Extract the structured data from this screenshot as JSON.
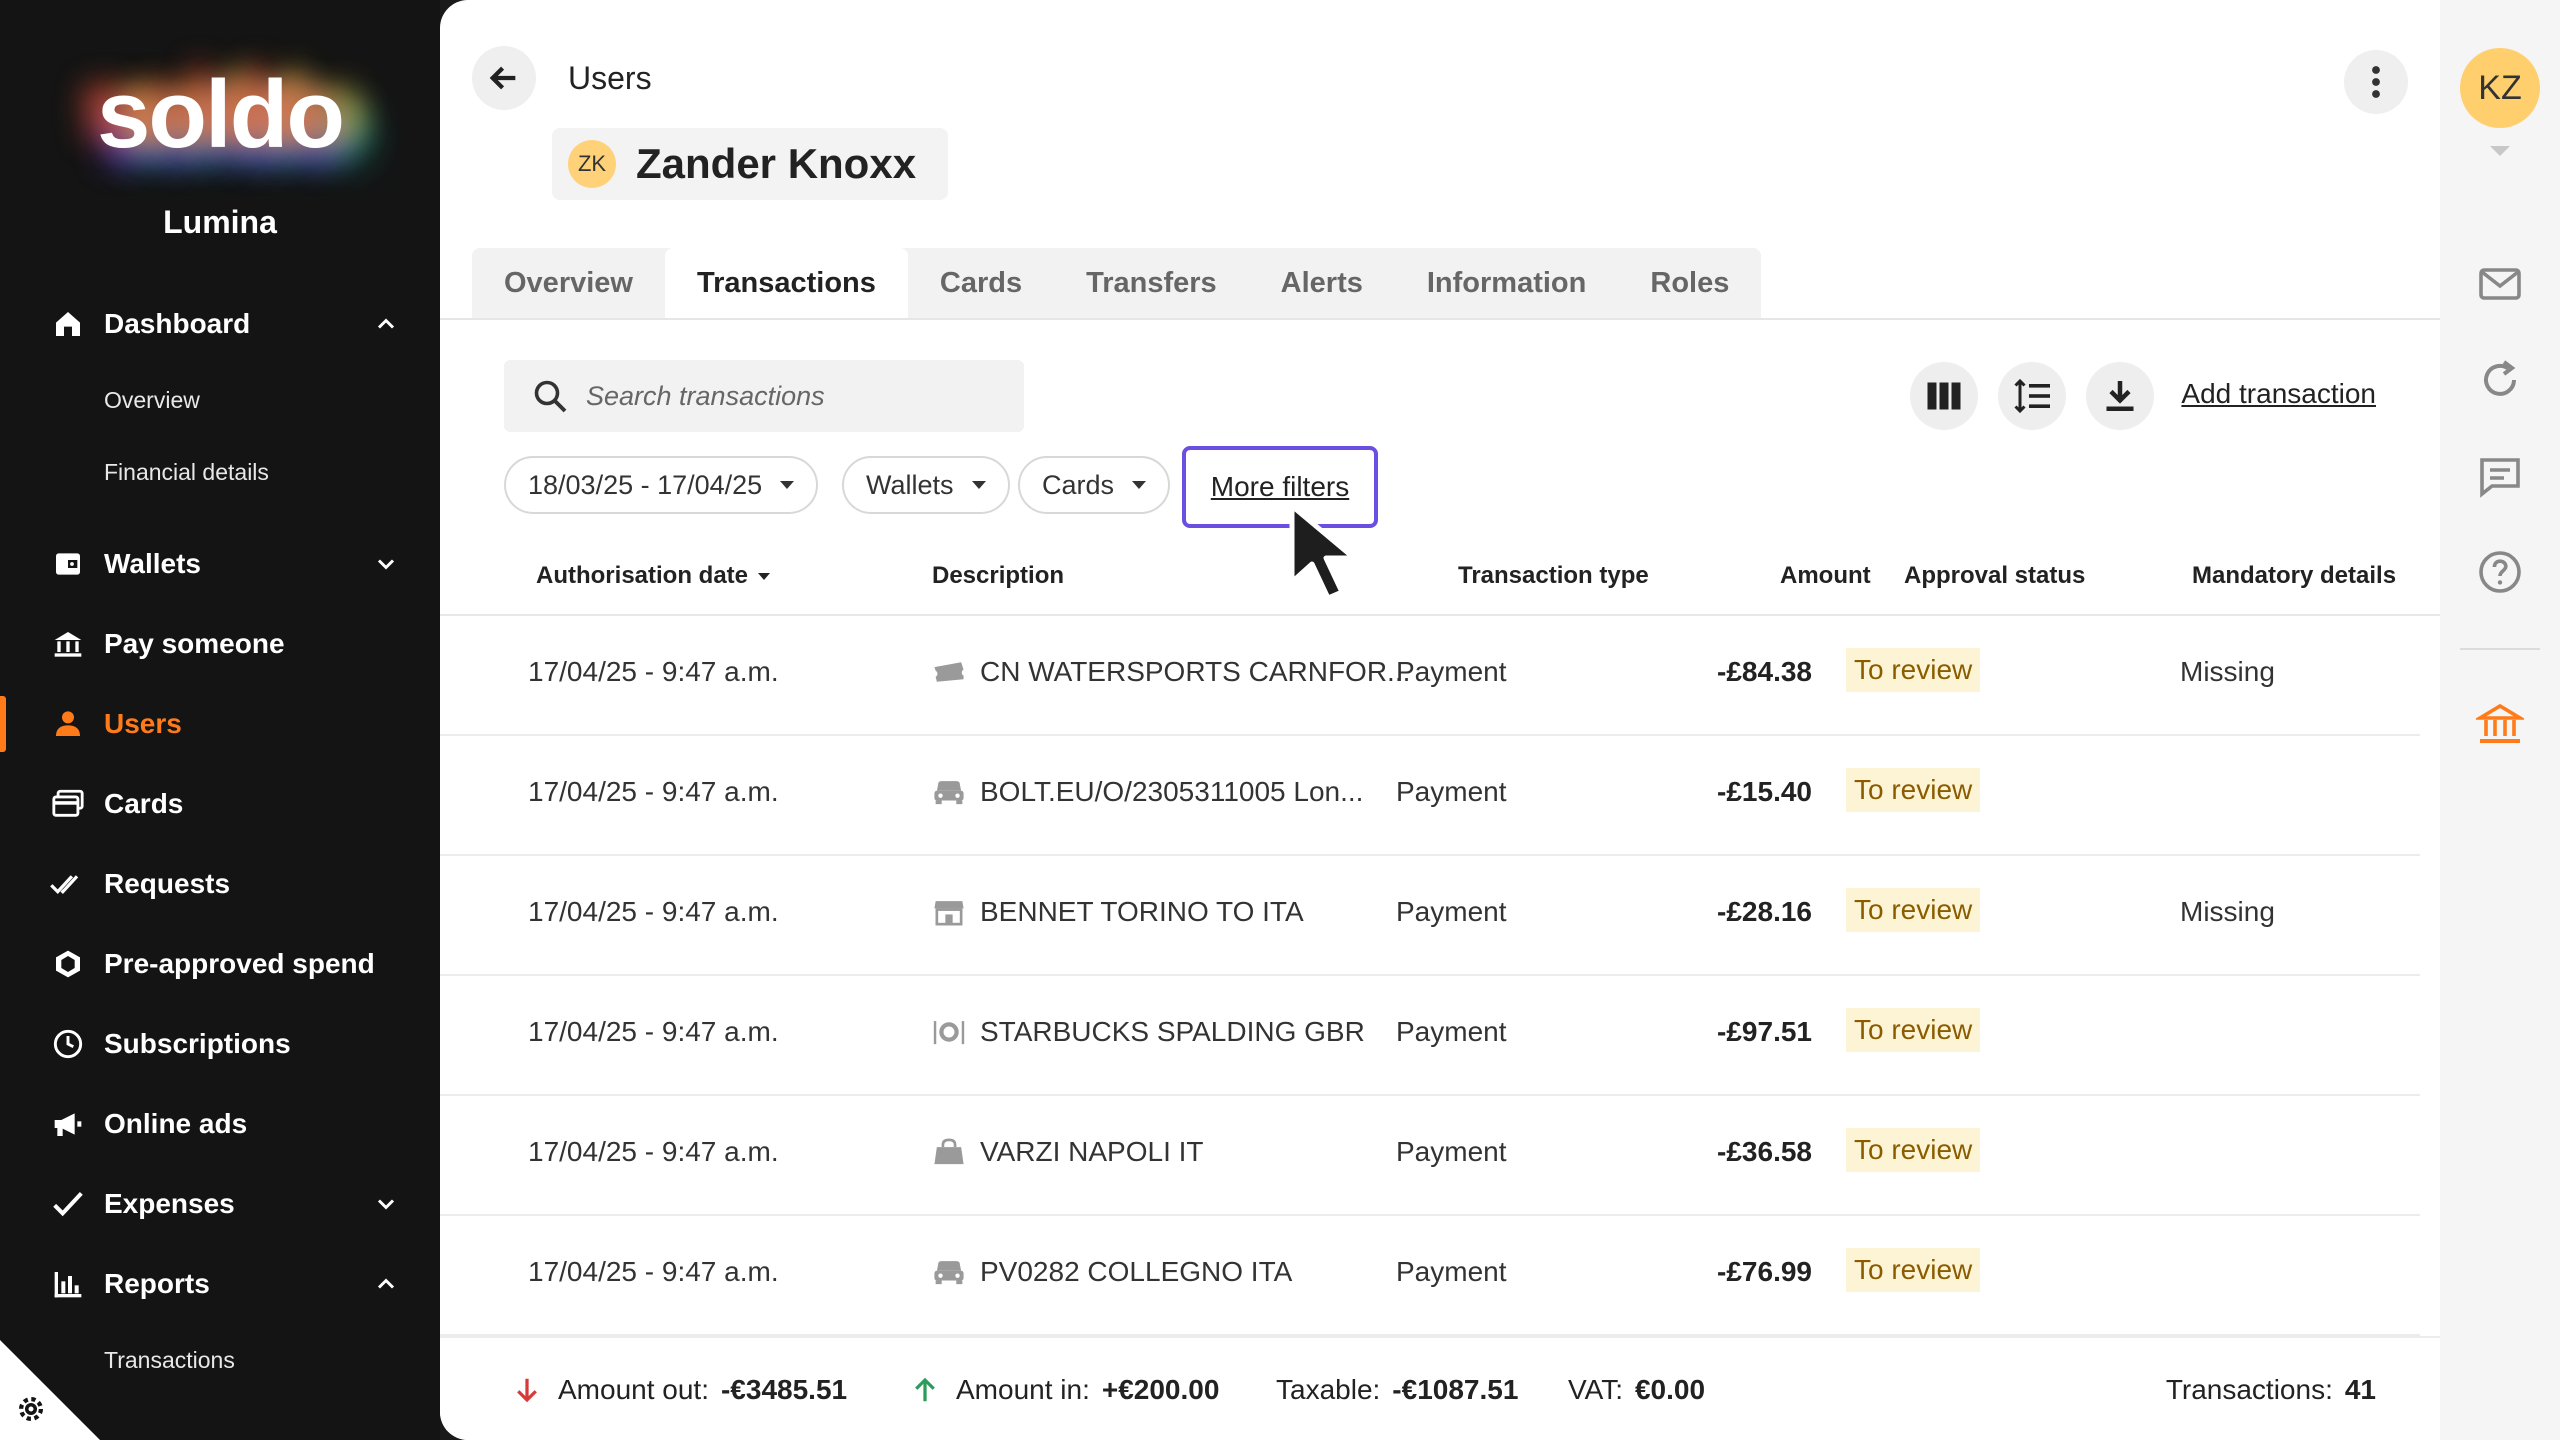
{
  "app": {
    "logo_text": "soldo",
    "org_name": "Lumina"
  },
  "sidebar": {
    "items": [
      {
        "label": "Dashboard",
        "icon": "home-icon",
        "expanded": true
      },
      {
        "label": "Overview"
      },
      {
        "label": "Financial details"
      },
      {
        "label": "Wallets",
        "icon": "wallet-icon",
        "expanded": false
      },
      {
        "label": "Pay someone",
        "icon": "bank-icon"
      },
      {
        "label": "Users",
        "icon": "user-icon",
        "active": true
      },
      {
        "label": "Cards",
        "icon": "cards-icon"
      },
      {
        "label": "Requests",
        "icon": "double-check-icon"
      },
      {
        "label": "Pre-approved spend",
        "icon": "hexagon-icon"
      },
      {
        "label": "Subscriptions",
        "icon": "clock-icon"
      },
      {
        "label": "Online ads",
        "icon": "megaphone-icon"
      },
      {
        "label": "Expenses",
        "icon": "check-icon",
        "expanded": false
      },
      {
        "label": "Reports",
        "icon": "bar-chart-icon",
        "expanded": true
      },
      {
        "label": "Transactions"
      }
    ]
  },
  "header": {
    "breadcrumb": "Users",
    "user_initials": "ZK",
    "user_name": "Zander Knoxx"
  },
  "tabs": [
    {
      "label": "Overview"
    },
    {
      "label": "Transactions",
      "active": true
    },
    {
      "label": "Cards"
    },
    {
      "label": "Transfers"
    },
    {
      "label": "Alerts"
    },
    {
      "label": "Information"
    },
    {
      "label": "Roles"
    }
  ],
  "toolbar": {
    "search_placeholder": "Search transactions",
    "add_transaction": "Add transaction"
  },
  "filters": {
    "date_range": "18/03/25 - 17/04/25",
    "wallets": "Wallets",
    "cards": "Cards",
    "more_filters": "More filters"
  },
  "table": {
    "columns": [
      "Authorisation date",
      "Description",
      "Transaction type",
      "Amount",
      "Approval status",
      "Mandatory details"
    ],
    "rows": [
      {
        "date": "17/04/25 - 9:47 a.m.",
        "icon": "ticket-icon",
        "description": "CN WATERSPORTS CARNFOR...",
        "type": "Payment",
        "amount": "-£84.38",
        "status": "To review",
        "mandatory": "Missing"
      },
      {
        "date": "17/04/25 - 9:47 a.m.",
        "icon": "car-icon",
        "description": "BOLT.EU/O/2305311005 Lon...",
        "type": "Payment",
        "amount": "-£15.40",
        "status": "To review",
        "mandatory": ""
      },
      {
        "date": "17/04/25 - 9:47 a.m.",
        "icon": "shop-icon",
        "description": "BENNET TORINO TO ITA",
        "type": "Payment",
        "amount": "-£28.16",
        "status": "To review",
        "mandatory": "Missing"
      },
      {
        "date": "17/04/25 - 9:47 a.m.",
        "icon": "restaurant-icon",
        "description": "STARBUCKS SPALDING GBR",
        "type": "Payment",
        "amount": "-£97.51",
        "status": "To review",
        "mandatory": ""
      },
      {
        "date": "17/04/25 - 9:47 a.m.",
        "icon": "shopping-bag-icon",
        "description": "VARZI NAPOLI IT",
        "type": "Payment",
        "amount": "-£36.58",
        "status": "To review",
        "mandatory": ""
      },
      {
        "date": "17/04/25 - 9:47 a.m.",
        "icon": "car-icon",
        "description": "PV0282 COLLEGNO ITA",
        "type": "Payment",
        "amount": "-£76.99",
        "status": "To review",
        "mandatory": ""
      }
    ]
  },
  "footer": {
    "amount_out_label": "Amount out:",
    "amount_out_value": "-€3485.51",
    "amount_in_label": "Amount in:",
    "amount_in_value": "+€200.00",
    "taxable_label": "Taxable:",
    "taxable_value": "-€1087.51",
    "vat_label": "VAT:",
    "vat_value": "€0.00",
    "transactions_label": "Transactions:",
    "transactions_value": "41"
  },
  "rail": {
    "initials": "KZ"
  },
  "colors": {
    "accent": "#ff7b1a",
    "focus_outline": "#6b4fe0",
    "status_bg": "#fdf4d6",
    "status_text": "#8a5c00",
    "out_arrow": "#d83a3a",
    "in_arrow": "#2e9b5a"
  }
}
